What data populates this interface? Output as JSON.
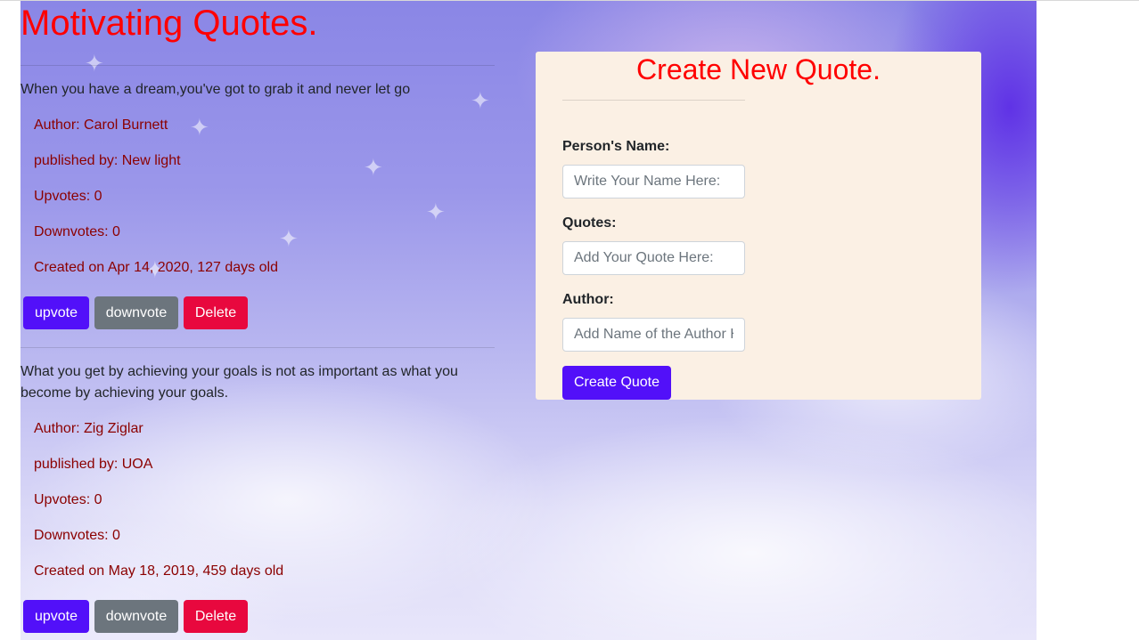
{
  "page": {
    "title": "Motivating Quotes."
  },
  "quotes": [
    {
      "text": "When you have a dream,you've got to grab it and never let go",
      "author": "Author: Carol Burnett",
      "publisher": "published by: New light",
      "upvotes": "Upvotes: 0",
      "downvotes": "Downvotes: 0",
      "created": "Created on Apr 14, 2020, 127 days old"
    },
    {
      "text": "What you get by achieving your goals is not as important as what you become by achieving your goals.",
      "author": "Author: Zig Ziglar",
      "publisher": "published by: UOA",
      "upvotes": "Upvotes: 0",
      "downvotes": "Downvotes: 0",
      "created": "Created on May 18, 2019, 459 days old"
    }
  ],
  "buttons": {
    "upvote": "upvote",
    "downvote": "downvote",
    "delete": "Delete"
  },
  "form": {
    "title": "Create New Quote.",
    "name_label": "Person's Name:",
    "name_placeholder": "Write Your Name Here:",
    "quote_label": "Quotes:",
    "quote_placeholder": "Add Your Quote Here:",
    "author_label": "Author:",
    "author_placeholder": "Add Name of the Author Here:",
    "submit_label": "Create Quote"
  },
  "colors": {
    "title": "#ff0000",
    "meta_text": "#8b0000",
    "primary_button": "#5210f9",
    "secondary_button": "#6c757d",
    "danger_button": "#e8083e",
    "panel_background": "#fbf0e4"
  },
  "icons": [
    "star-decoration"
  ]
}
